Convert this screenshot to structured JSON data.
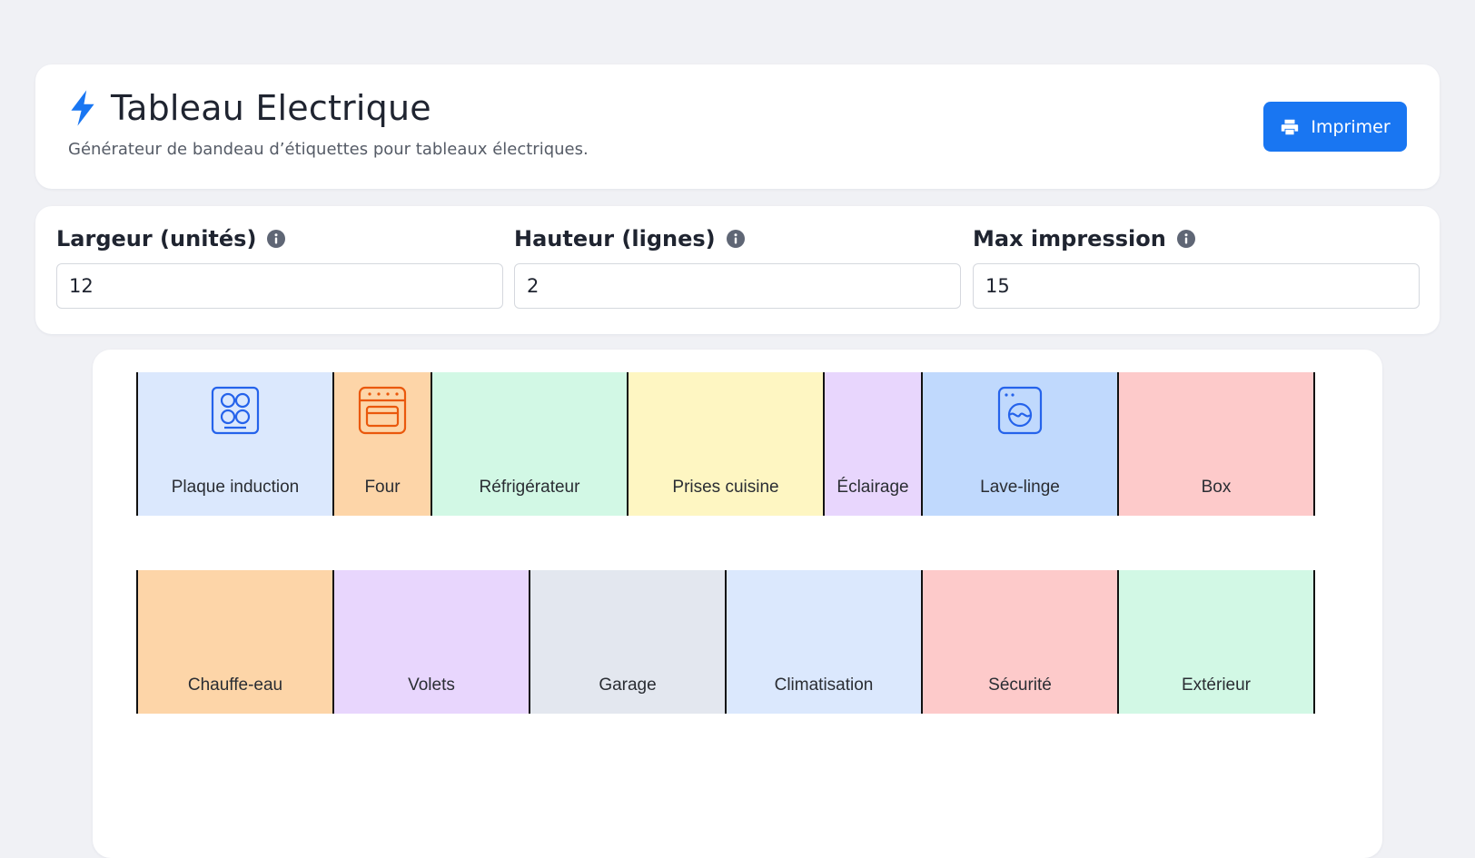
{
  "header": {
    "title": "Tableau Electrique",
    "subtitle": "Générateur de bandeau d’étiquettes pour tableaux électriques.",
    "print_label": "Imprimer"
  },
  "settings": {
    "width": {
      "label": "Largeur (unités)",
      "value": "12"
    },
    "height": {
      "label": "Hauteur (lignes)",
      "value": "2"
    },
    "max": {
      "label": "Max impression",
      "value": "15"
    }
  },
  "colors": {
    "accent": "#1976f2",
    "blue": "#dbe8fd",
    "orange": "#fdd5a8",
    "green": "#d2f8e5",
    "yellow": "#fef6c2",
    "purple": "#e8d6fd",
    "blue2": "#c0d9fd",
    "red": "#fdcaca",
    "grey": "#e3e7ef"
  },
  "rows": [
    [
      {
        "label": "Plaque induction",
        "units": 2,
        "color": "blue",
        "icon": "induction-hob-icon",
        "icon_color": "#2563eb"
      },
      {
        "label": "Four",
        "units": 1,
        "color": "orange",
        "icon": "oven-icon",
        "icon_color": "#ea580c"
      },
      {
        "label": "Réfrigérateur",
        "units": 2,
        "color": "green"
      },
      {
        "label": "Prises cuisine",
        "units": 2,
        "color": "yellow"
      },
      {
        "label": "Éclairage",
        "units": 1,
        "color": "purple"
      },
      {
        "label": "Lave-linge",
        "units": 2,
        "color": "blue2",
        "icon": "washing-machine-icon",
        "icon_color": "#2563eb"
      },
      {
        "label": "Box",
        "units": 2,
        "color": "red"
      }
    ],
    [
      {
        "label": "Chauffe-eau",
        "units": 2,
        "color": "orange"
      },
      {
        "label": "Volets",
        "units": 2,
        "color": "purple"
      },
      {
        "label": "Garage",
        "units": 2,
        "color": "grey"
      },
      {
        "label": "Climatisation",
        "units": 2,
        "color": "blue"
      },
      {
        "label": "Sécurité",
        "units": 2,
        "color": "red"
      },
      {
        "label": "Extérieur",
        "units": 2,
        "color": "green"
      }
    ]
  ]
}
